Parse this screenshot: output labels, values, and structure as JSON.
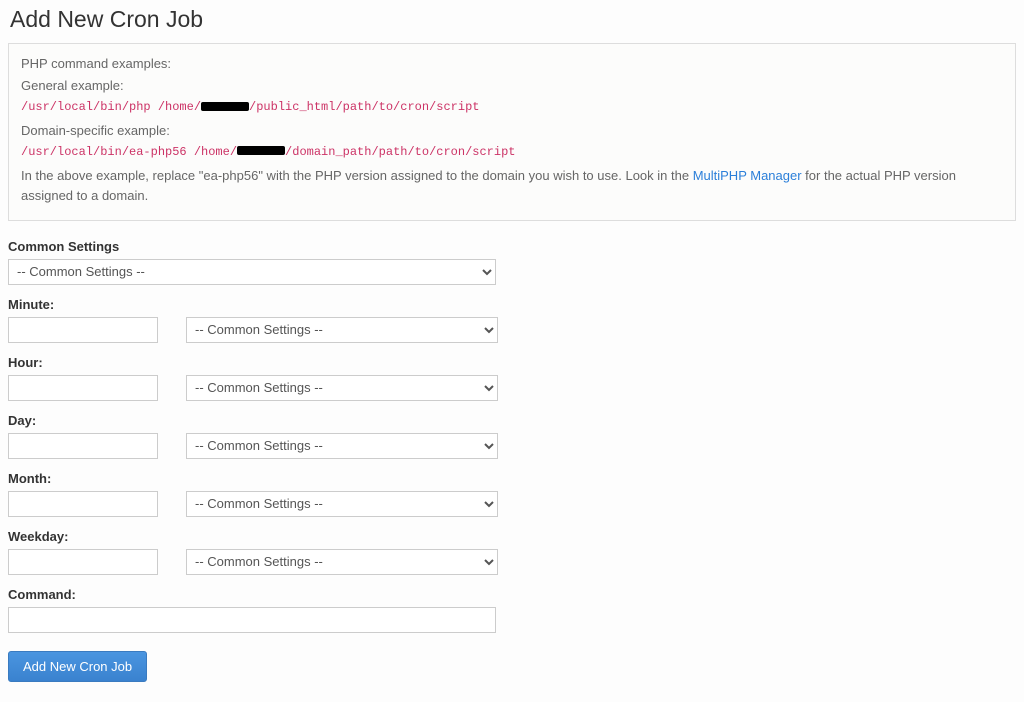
{
  "page_title": "Add New Cron Job",
  "info": {
    "heading": "PHP command examples:",
    "general_label": "General example:",
    "general_pre": "/usr/local/bin/php /home/",
    "general_post": "/public_html/path/to/cron/script",
    "domain_label": "Domain-specific example:",
    "domain_pre": "/usr/local/bin/ea-php56 /home/",
    "domain_post": "/domain_path/path/to/cron/script",
    "note_pre": "In the above example, replace \"ea-php56\" with the PHP version assigned to the domain you wish to use. Look in the ",
    "note_link": "MultiPHP Manager",
    "note_post": " for the actual PHP version assigned to a domain."
  },
  "labels": {
    "common": "Common Settings",
    "minute": "Minute:",
    "hour": "Hour:",
    "day": "Day:",
    "month": "Month:",
    "weekday": "Weekday:",
    "command": "Command:"
  },
  "dropdown_placeholder": "-- Common Settings --",
  "submit_label": "Add New Cron Job"
}
